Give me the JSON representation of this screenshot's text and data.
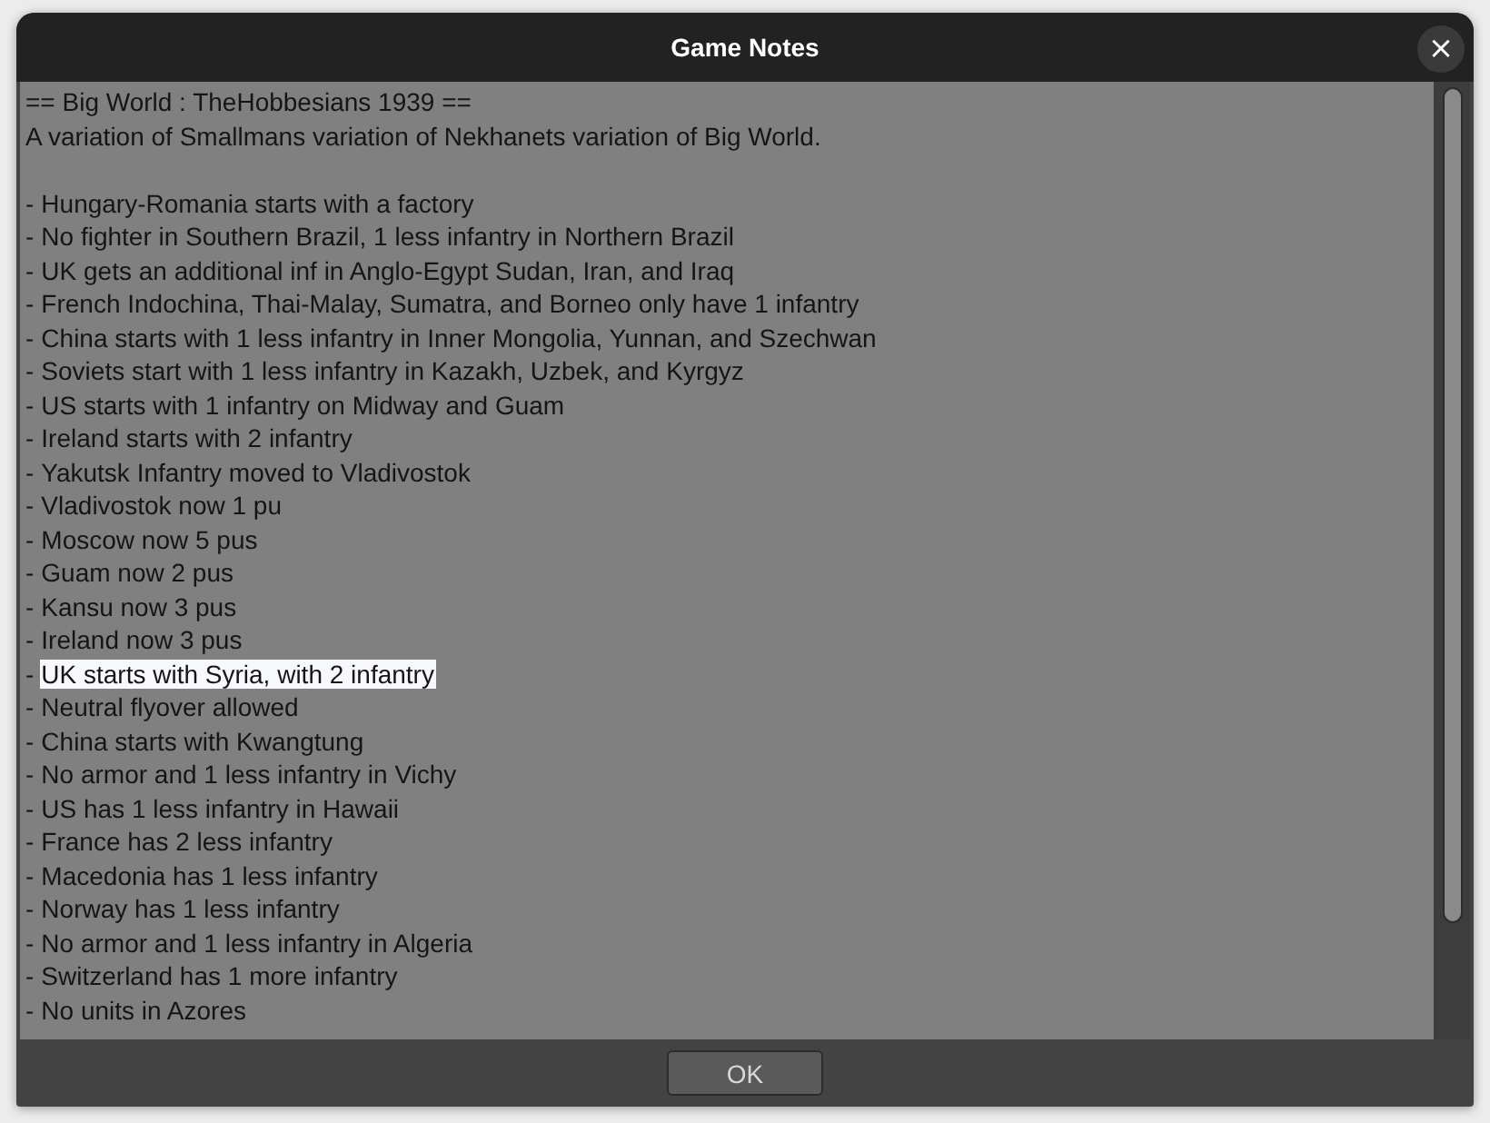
{
  "window": {
    "title": "Game Notes",
    "close": "×"
  },
  "notes": {
    "heading": "== Big World : TheHobbesians 1939 ==",
    "intro": "A variation of Smallmans variation of Nekhanets variation of Big World.",
    "items": [
      {
        "bullet": "-",
        "text": "Hungary-Romania starts with a factory",
        "selected": false
      },
      {
        "bullet": "-",
        "text": "No fighter in Southern Brazil, 1 less infantry in Northern Brazil",
        "selected": false
      },
      {
        "bullet": "-",
        "text": "UK gets an additional inf in Anglo-Egypt Sudan, Iran, and Iraq",
        "selected": false
      },
      {
        "bullet": "-",
        "text": "French Indochina, Thai-Malay, Sumatra, and Borneo only have 1 infantry",
        "selected": false
      },
      {
        "bullet": "-",
        "text": "China starts with 1 less infantry in Inner Mongolia, Yunnan, and Szechwan",
        "selected": false
      },
      {
        "bullet": "-",
        "text": "Soviets start with 1 less infantry in Kazakh, Uzbek, and Kyrgyz",
        "selected": false
      },
      {
        "bullet": "-",
        "text": "US starts with 1 infantry on Midway and Guam",
        "selected": false
      },
      {
        "bullet": "-",
        "text": "Ireland starts with 2 infantry",
        "selected": false
      },
      {
        "bullet": "-",
        "text": "Yakutsk Infantry moved to Vladivostok",
        "selected": false
      },
      {
        "bullet": "-",
        "text": "Vladivostok now 1 pu",
        "selected": false
      },
      {
        "bullet": "-",
        "text": "Moscow now 5 pus",
        "selected": false
      },
      {
        "bullet": "-",
        "text": "Guam now 2 pus",
        "selected": false
      },
      {
        "bullet": "-",
        "text": "Kansu now 3 pus",
        "selected": false
      },
      {
        "bullet": "-",
        "text": "Ireland now 3 pus",
        "selected": false
      },
      {
        "bullet": "-",
        "text": "UK starts with Syria, with 2 infantry",
        "selected": true
      },
      {
        "bullet": "-",
        "text": "Neutral flyover allowed",
        "selected": false
      },
      {
        "bullet": "-",
        "text": "China starts with Kwangtung",
        "selected": false
      },
      {
        "bullet": "-",
        "text": "No armor and 1 less infantry in Vichy",
        "selected": false
      },
      {
        "bullet": "-",
        "text": "US has 1 less infantry in Hawaii",
        "selected": false
      },
      {
        "bullet": "-",
        "text": "France has 2 less infantry",
        "selected": false
      },
      {
        "bullet": "-",
        "text": "Macedonia has 1 less infantry",
        "selected": false
      },
      {
        "bullet": "-",
        "text": "Norway has 1 less infantry",
        "selected": false
      },
      {
        "bullet": "-",
        "text": "No armor and 1 less infantry in Algeria",
        "selected": false
      },
      {
        "bullet": "-",
        "text": "Switzerland has 1 more infantry",
        "selected": false
      },
      {
        "bullet": "-",
        "text": "No units in Azores",
        "selected": false
      }
    ]
  },
  "buttons": [
    "OK"
  ]
}
